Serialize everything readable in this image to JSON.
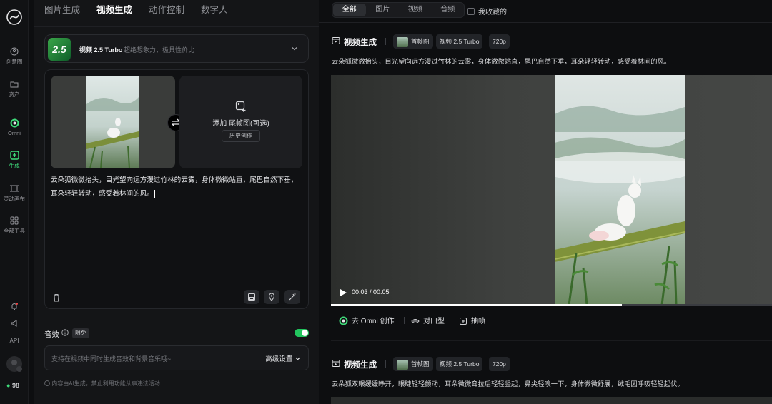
{
  "rail": {
    "items": [
      {
        "label": "创意圈",
        "icon": "inspiration-icon"
      },
      {
        "label": "资产",
        "icon": "folder-icon"
      },
      {
        "label": "Omni",
        "icon": "omni-icon"
      },
      {
        "label": "生成",
        "icon": "generate-icon"
      },
      {
        "label": "灵动画布",
        "icon": "canvas-icon"
      },
      {
        "label": "全部工具",
        "icon": "grid-icon"
      }
    ],
    "api_label": "API",
    "credits": "98"
  },
  "panel": {
    "tabs": [
      "图片生成",
      "视频生成",
      "动作控制",
      "数字人"
    ],
    "active_tab": "视频生成",
    "model": {
      "badge": "2.5",
      "name": "视频 2.5 Turbo",
      "desc": "超绝想象力，极具性价比"
    },
    "add_end_frame": "添加 尾帧图(可选)",
    "history": "历史创作",
    "prompt": "云朵狐微微抬头，目光望向远方漫过竹林的云雾，身体微微站直，尾巴自然下垂，耳朵轻轻转动，感受着林间的风。",
    "sfx_label": "音效",
    "sfx_tag": "限免",
    "sfx_placeholder": "支持在视频中同时生成音效和背景音乐哦~",
    "advanced": "高级设置",
    "disclaimer": "内容由AI生成，禁止利用功能从事违法活动"
  },
  "right": {
    "filters": [
      "全部",
      "图片",
      "视频",
      "音频"
    ],
    "favorites": "我收藏的",
    "cards": [
      {
        "title": "视频生成",
        "chips": [
          "首帧图",
          "视频 2.5 Turbo",
          "720p"
        ],
        "text": "云朵狐微微抬头，目光望向远方漫过竹林的云雾，身体微微站直，尾巴自然下垂，耳朵轻轻转动，感受着林间的风。",
        "time": "00:03 / 00:05",
        "progress": 0.66,
        "actions": [
          "去 Omni 创作",
          "对口型",
          "抽帧"
        ]
      },
      {
        "title": "视频生成",
        "chips": [
          "首帧图",
          "视频 2.5 Turbo",
          "720p"
        ],
        "text": "云朵狐双眼缓缓睁开，眼睫轻轻颤动，耳朵微微耷拉后轻轻竖起，鼻尖轻嗅一下，身体微微舒展，绒毛因呼吸轻轻起伏。"
      }
    ]
  }
}
